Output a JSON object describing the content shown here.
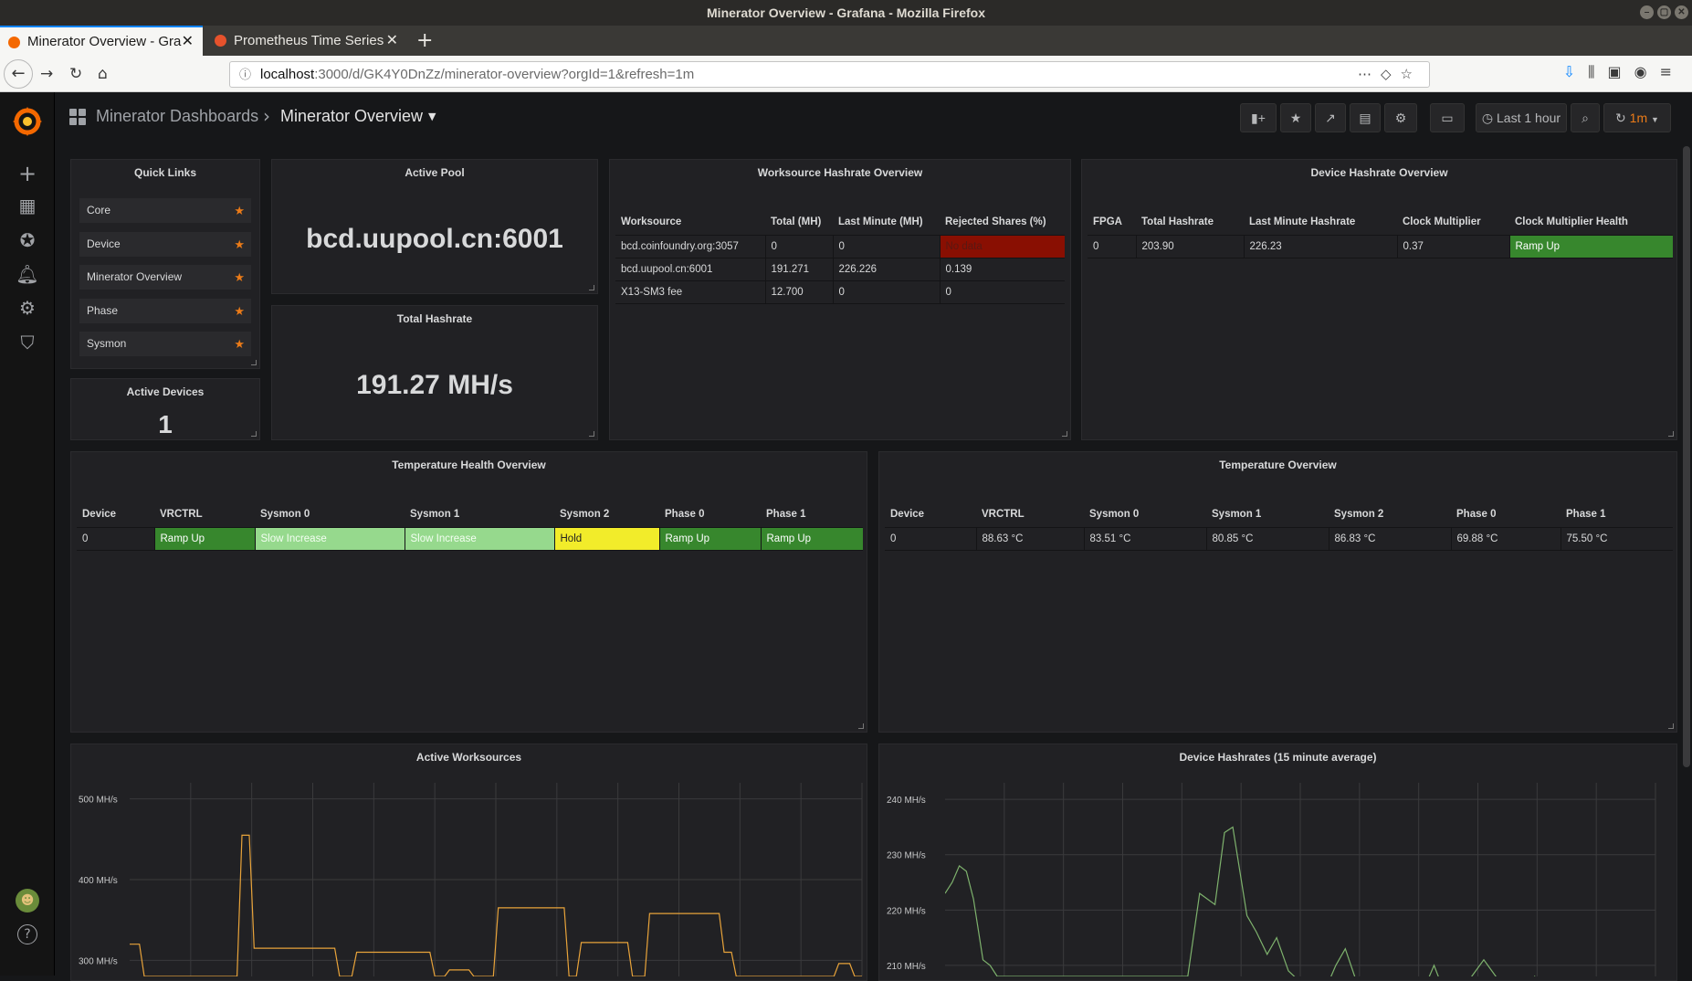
{
  "window": {
    "title": "Minerator Overview - Grafana - Mozilla Firefox"
  },
  "tabs": [
    {
      "label": "Minerator Overview - Gra",
      "active": true
    },
    {
      "label": "Prometheus Time Series",
      "active": false
    }
  ],
  "url": {
    "host": "localhost",
    "path": ":3000/d/GK4Y0DnZz/minerator-overview?orgId=1&refresh=1m"
  },
  "grafana": {
    "breadcrumb": {
      "folder": "Minerator Dashboards",
      "title": "Minerator Overview"
    },
    "toolbar": {
      "time_range": "Last 1 hour",
      "refresh": "1m"
    },
    "sidemenu": [
      "create-icon",
      "dashboards-icon",
      "explore-icon",
      "alerting-icon",
      "configuration-icon",
      "server-admin-icon",
      "user-avatar",
      "help-icon"
    ]
  },
  "panels": {
    "quick_links": {
      "title": "Quick Links",
      "items": [
        "Core",
        "Device",
        "Minerator Overview",
        "Phase",
        "Sysmon"
      ]
    },
    "active_pool": {
      "title": "Active Pool",
      "value": "bcd.uupool.cn:6001"
    },
    "total_hashrate": {
      "title": "Total Hashrate",
      "value": "191.27 MH/s"
    },
    "active_devices": {
      "title": "Active Devices",
      "value": "1"
    },
    "worksource_overview": {
      "title": "Worksource Hashrate Overview",
      "columns": [
        "Worksource",
        "Total (MH)",
        "Last Minute (MH)",
        "Rejected Shares (%)"
      ],
      "rows": [
        [
          "bcd.coinfoundry.org:3057",
          "0",
          "0",
          "No data"
        ],
        [
          "bcd.uupool.cn:6001",
          "191.271",
          "226.226",
          "0.139"
        ],
        [
          "X13-SM3 fee",
          "12.700",
          "0",
          "0"
        ]
      ],
      "status_color": "#890f02"
    },
    "device_overview": {
      "title": "Device Hashrate Overview",
      "columns": [
        "FPGA",
        "Total Hashrate",
        "Last Minute Hashrate",
        "Clock Multiplier",
        "Clock Multiplier Health"
      ],
      "rows": [
        [
          "0",
          "203.90",
          "226.23",
          "0.37",
          "Ramp Up"
        ]
      ],
      "health_color": "#37872d"
    },
    "temperature_health": {
      "title": "Temperature Health Overview",
      "columns": [
        "Device",
        "VRCTRL",
        "Sysmon 0",
        "Sysmon 1",
        "Sysmon 2",
        "Phase 0",
        "Phase 1"
      ],
      "rows": [
        [
          "0",
          "Ramp Up",
          "Slow Increase",
          "Slow Increase",
          "Hold",
          "Ramp Up",
          "Ramp Up"
        ]
      ],
      "colors": {
        "Ramp Up": "#37872d",
        "Slow Increase": "#96d98d",
        "Hold": "#f2ec2a"
      }
    },
    "temperature_overview": {
      "title": "Temperature Overview",
      "columns": [
        "Device",
        "VRCTRL",
        "Sysmon 0",
        "Sysmon 1",
        "Sysmon 2",
        "Phase 0",
        "Phase 1"
      ],
      "rows": [
        [
          "0",
          "88.63 °C",
          "83.51 °C",
          "80.85 °C",
          "86.83 °C",
          "69.88 °C",
          "75.50 °C"
        ]
      ]
    },
    "active_worksources": {
      "title": "Active Worksources"
    },
    "device_hashrates": {
      "title": "Device Hashrates (15 minute average)"
    }
  },
  "chart_data": [
    {
      "type": "line",
      "title": "Active Worksources",
      "yticks": [
        "500 MH/s",
        "400 MH/s",
        "300 MH/s"
      ],
      "ytick_values": [
        500,
        400,
        300
      ],
      "ylim": [
        280,
        520
      ],
      "xlim": [
        0,
        60
      ],
      "color": "#e8a33a",
      "series": [
        {
          "x": [
            0,
            0.8,
            1.2,
            8.8,
            9.2,
            9.8,
            10.2,
            16.8,
            17.2,
            18.2,
            18.6,
            24.6,
            25,
            25.8,
            26.2,
            27.8,
            28.2,
            29.8,
            30.2,
            35.6,
            36,
            36.6,
            37,
            40.8,
            41.2,
            42.2,
            42.6,
            48.3,
            48.7,
            49.3,
            49.7,
            57.7,
            58.1,
            59,
            59.4,
            60
          ],
          "y": [
            320,
            320,
            280,
            280,
            455,
            455,
            315,
            315,
            280,
            280,
            310,
            310,
            280,
            280,
            288,
            288,
            280,
            280,
            365,
            365,
            280,
            280,
            322,
            322,
            280,
            280,
            358,
            358,
            310,
            310,
            280,
            280,
            296,
            296,
            280,
            280
          ]
        }
      ]
    },
    {
      "type": "line",
      "title": "Device Hashrates (15 minute average)",
      "yticks": [
        "240 MH/s",
        "230 MH/s",
        "220 MH/s",
        "210 MH/s"
      ],
      "ytick_values": [
        240,
        230,
        220,
        210
      ],
      "ylim": [
        208,
        243
      ],
      "xlim": [
        0,
        60
      ],
      "color": "#7eb26d",
      "series": [
        {
          "x": [
            0,
            0.6,
            1.2,
            1.8,
            2.4,
            3.2,
            3.8,
            4.4,
            20.5,
            21.5,
            22.8,
            23.6,
            24.3,
            25.5,
            26.3,
            27.2,
            28.0,
            29.0,
            30.0,
            31.0,
            31.6,
            32.2,
            33.0,
            33.8,
            34.6,
            35.5,
            36.3,
            37.4,
            38.5,
            39.5,
            40.5,
            41.3,
            42.2,
            43.0,
            43.8,
            45.5,
            47.2,
            48.0,
            48.8,
            49.8,
            50.6,
            51.3,
            53.0,
            55.0,
            57.0,
            58.0,
            60.0
          ],
          "y": [
            223,
            225,
            228,
            227,
            222,
            211,
            210,
            208,
            208,
            223,
            221,
            234,
            235,
            219,
            216,
            212,
            215,
            209,
            207,
            206,
            207,
            206,
            210,
            213,
            208,
            206,
            204,
            206,
            205,
            204,
            206,
            210,
            205,
            204,
            206,
            211,
            206,
            204,
            205,
            208,
            206,
            204,
            205,
            204,
            205,
            206,
            205
          ]
        }
      ]
    }
  ]
}
